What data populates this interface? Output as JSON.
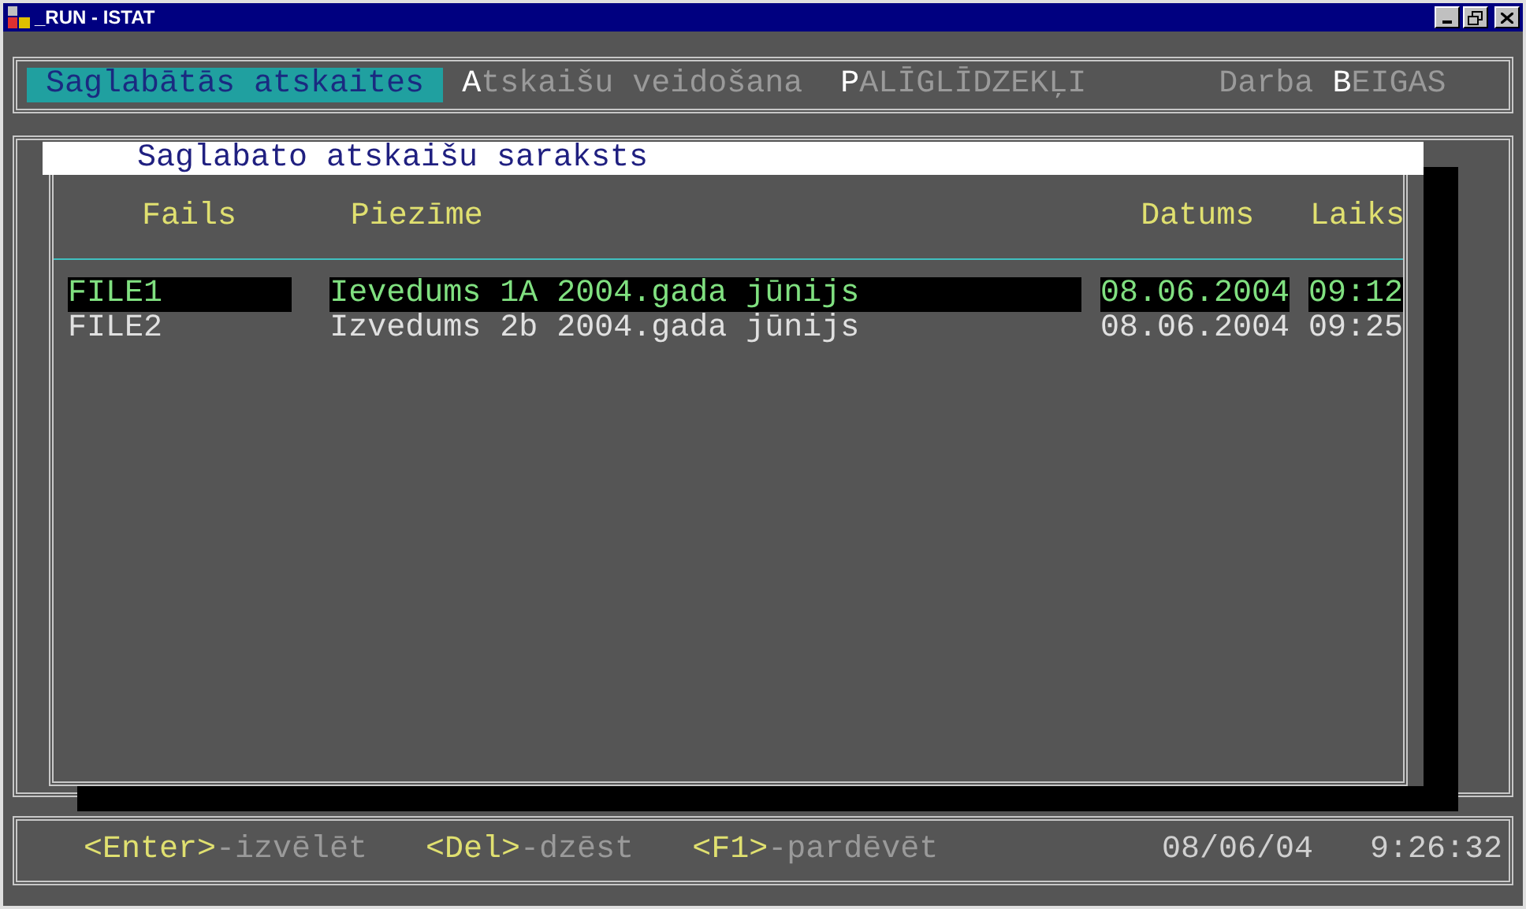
{
  "window": {
    "title": "_RUN - ISTAT"
  },
  "menu": [
    {
      "hotkey": "S",
      "after": "aglabātās atskaites",
      "selected": true
    },
    {
      "hotkey": "A",
      "after": "tskaišu veidošana",
      "selected": false
    },
    {
      "hotkey": "P",
      "after": "ALĪGLĪDZEKĻI",
      "selected": false
    },
    {
      "before": "Darba ",
      "hotkey": "B",
      "after": "EIGAS",
      "selected": false
    }
  ],
  "panel": {
    "title": "Saglabato atskaišu saraksts",
    "columns": [
      "Fails",
      "Piezīme",
      "Datums",
      "Laiks"
    ],
    "rows": [
      {
        "cells": [
          "FILE1",
          "Ievedums 1A 2004.gada jūnijs",
          "08.06.2004",
          "09:12"
        ],
        "selected": true
      },
      {
        "cells": [
          "FILE2",
          "Izvedums 2b 2004.gada jūnijs",
          "08.06.2004",
          "09:25"
        ],
        "selected": false
      }
    ]
  },
  "footer": {
    "keys": [
      {
        "key": "<Enter>",
        "action": "-izvēlēt"
      },
      {
        "key": "<Del>",
        "action": "-dzēst"
      },
      {
        "key": "<F1>",
        "action": "-pardēvēt"
      }
    ],
    "date": "08/06/04",
    "time": "9:26:32"
  }
}
